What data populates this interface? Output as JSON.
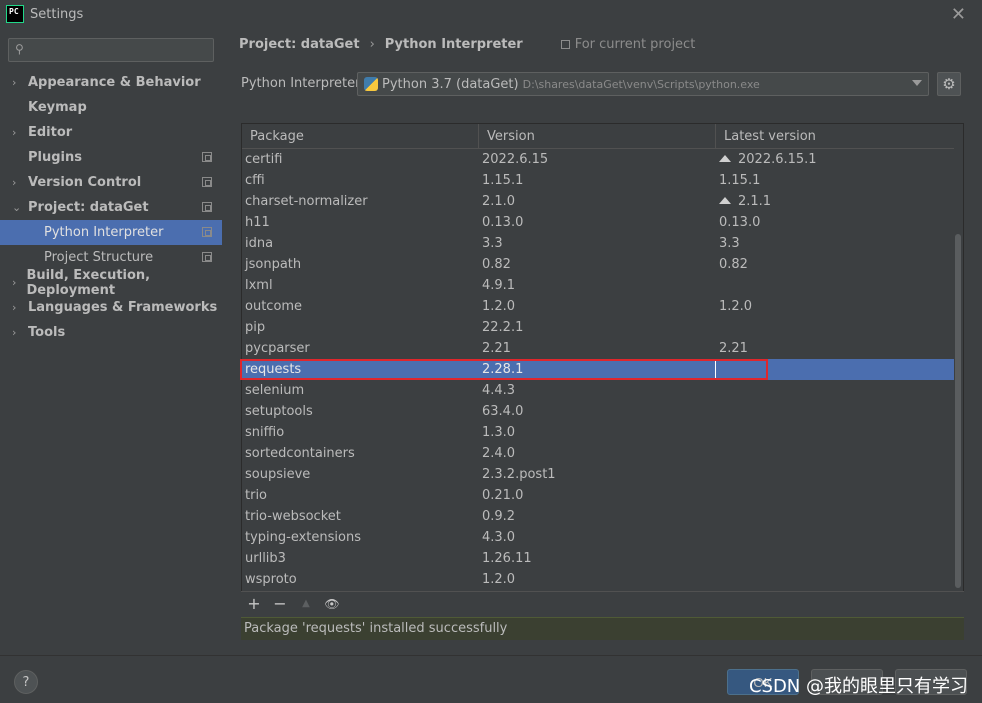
{
  "window": {
    "title": "Settings",
    "logo_text": "PC",
    "close_glyph": "✕"
  },
  "sidebar": {
    "search": {
      "value": "",
      "placeholder": ""
    },
    "items": [
      {
        "label": "Appearance & Behavior",
        "chevron": "›",
        "copy_icon": false
      },
      {
        "label": "Keymap",
        "chevron": "",
        "copy_icon": false
      },
      {
        "label": "Editor",
        "chevron": "›",
        "copy_icon": false
      },
      {
        "label": "Plugins",
        "chevron": "",
        "copy_icon": true
      },
      {
        "label": "Version Control",
        "chevron": "›",
        "copy_icon": true
      },
      {
        "label": "Project: dataGet",
        "chevron": "⌄",
        "copy_icon": true
      },
      {
        "label": "Python Interpreter",
        "chevron": "",
        "copy_icon": true,
        "sub": true,
        "selected": true
      },
      {
        "label": "Project Structure",
        "chevron": "",
        "copy_icon": true,
        "sub": true
      },
      {
        "label": "Build, Execution, Deployment",
        "chevron": "›",
        "copy_icon": false
      },
      {
        "label": "Languages & Frameworks",
        "chevron": "›",
        "copy_icon": false
      },
      {
        "label": "Tools",
        "chevron": "›",
        "copy_icon": false
      }
    ]
  },
  "breadcrumb": {
    "project": "Project: dataGet",
    "separator": "›",
    "page": "Python Interpreter",
    "scope": "For current project"
  },
  "interpreter": {
    "label": "Python Interpreter:",
    "name": "Python 3.7 (dataGet)",
    "path": "D:\\shares\\dataGet\\venv\\Scripts\\python.exe"
  },
  "table": {
    "headers": [
      "Package",
      "Version",
      "Latest version"
    ],
    "rows": [
      {
        "package": "certifi",
        "version": "2022.6.15",
        "latest": "2022.6.15.1",
        "upgrade": true
      },
      {
        "package": "cffi",
        "version": "1.15.1",
        "latest": "1.15.1",
        "upgrade": false
      },
      {
        "package": "charset-normalizer",
        "version": "2.1.0",
        "latest": "2.1.1",
        "upgrade": true
      },
      {
        "package": "h11",
        "version": "0.13.0",
        "latest": "0.13.0",
        "upgrade": false
      },
      {
        "package": "idna",
        "version": "3.3",
        "latest": "3.3",
        "upgrade": false
      },
      {
        "package": "jsonpath",
        "version": "0.82",
        "latest": "0.82",
        "upgrade": false
      },
      {
        "package": "lxml",
        "version": "4.9.1",
        "latest": "",
        "upgrade": false
      },
      {
        "package": "outcome",
        "version": "1.2.0",
        "latest": "1.2.0",
        "upgrade": false
      },
      {
        "package": "pip",
        "version": "22.2.1",
        "latest": "",
        "upgrade": false
      },
      {
        "package": "pycparser",
        "version": "2.21",
        "latest": "2.21",
        "upgrade": false
      },
      {
        "package": "requests",
        "version": "2.28.1",
        "latest": "",
        "upgrade": false,
        "selected": true
      },
      {
        "package": "selenium",
        "version": "4.4.3",
        "latest": "",
        "upgrade": false
      },
      {
        "package": "setuptools",
        "version": "63.4.0",
        "latest": "",
        "upgrade": false
      },
      {
        "package": "sniffio",
        "version": "1.3.0",
        "latest": "",
        "upgrade": false
      },
      {
        "package": "sortedcontainers",
        "version": "2.4.0",
        "latest": "",
        "upgrade": false
      },
      {
        "package": "soupsieve",
        "version": "2.3.2.post1",
        "latest": "",
        "upgrade": false
      },
      {
        "package": "trio",
        "version": "0.21.0",
        "latest": "",
        "upgrade": false
      },
      {
        "package": "trio-websocket",
        "version": "0.9.2",
        "latest": "",
        "upgrade": false
      },
      {
        "package": "typing-extensions",
        "version": "4.3.0",
        "latest": "",
        "upgrade": false
      },
      {
        "package": "urllib3",
        "version": "1.26.11",
        "latest": "",
        "upgrade": false
      },
      {
        "package": "wsproto",
        "version": "1.2.0",
        "latest": "",
        "upgrade": false
      }
    ]
  },
  "toolbar": {
    "add": "+",
    "remove": "−",
    "upgrade": "▲",
    "show": "👁"
  },
  "status": {
    "message": "Package 'requests' installed successfully"
  },
  "footer": {
    "help": "?",
    "ok": "OK",
    "cancel": "",
    "apply": "",
    "watermark": "CSDN @我的眼里只有学习"
  },
  "colors": {
    "background": "#3c3f41",
    "selection": "#4b6eaf",
    "highlight_box": "#e0262c",
    "status_bg": "#3b4031"
  }
}
